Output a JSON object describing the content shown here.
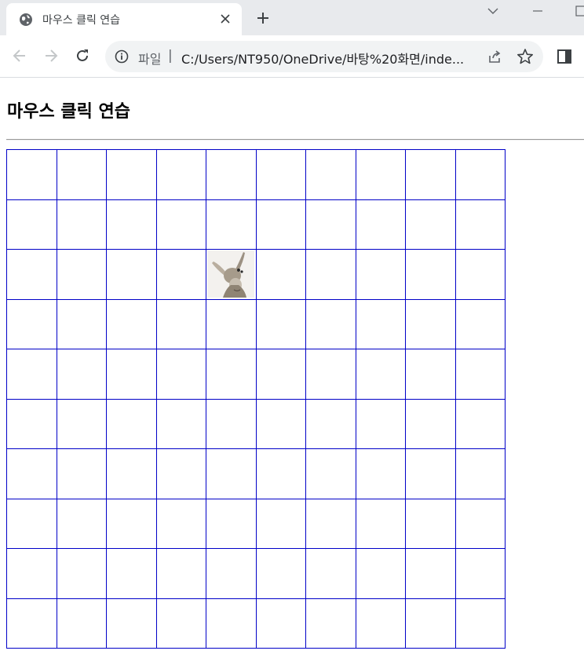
{
  "browser": {
    "tab_title": "마우스 클릭 연습",
    "address": {
      "scheme_label": "파일",
      "separator": "|",
      "url": "C:/Users/NT950/OneDrive/바탕%20화면/inde..."
    }
  },
  "page": {
    "heading": "마우스 클릭 연습",
    "grid": {
      "rows": 10,
      "cols": 10,
      "target": {
        "row": 3,
        "col": 5,
        "icon": "donkey-image"
      },
      "border_color": "#0000c8"
    }
  }
}
